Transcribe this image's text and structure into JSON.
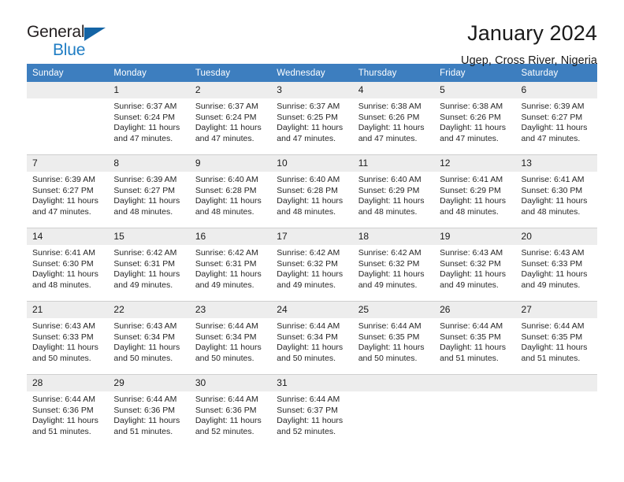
{
  "brand": {
    "line1": "General",
    "line2": "Blue",
    "triangle_icon": "brand-triangle-icon",
    "accent_dark": "#1464a5",
    "accent_light": "#1f7dc4"
  },
  "header": {
    "title": "January 2024",
    "subtitle": "Ugep, Cross River, Nigeria"
  },
  "theme": {
    "header_bg": "#3d7ebf",
    "header_text": "#ffffff",
    "band_bg": "#ededed",
    "row_border": "#cfcfcf",
    "body_text": "#262626"
  },
  "calendar": {
    "columns": [
      "Sunday",
      "Monday",
      "Tuesday",
      "Wednesday",
      "Thursday",
      "Friday",
      "Saturday"
    ],
    "labels": {
      "sunrise": "Sunrise:",
      "sunset": "Sunset:",
      "daylight": "Daylight:"
    },
    "weeks": [
      {
        "banded": true,
        "days": [
          {
            "num": "",
            "sunrise": "",
            "sunset": "",
            "daylight": ""
          },
          {
            "num": "1",
            "sunrise": "Sunrise: 6:37 AM",
            "sunset": "Sunset: 6:24 PM",
            "daylight": "Daylight: 11 hours and 47 minutes."
          },
          {
            "num": "2",
            "sunrise": "Sunrise: 6:37 AM",
            "sunset": "Sunset: 6:24 PM",
            "daylight": "Daylight: 11 hours and 47 minutes."
          },
          {
            "num": "3",
            "sunrise": "Sunrise: 6:37 AM",
            "sunset": "Sunset: 6:25 PM",
            "daylight": "Daylight: 11 hours and 47 minutes."
          },
          {
            "num": "4",
            "sunrise": "Sunrise: 6:38 AM",
            "sunset": "Sunset: 6:26 PM",
            "daylight": "Daylight: 11 hours and 47 minutes."
          },
          {
            "num": "5",
            "sunrise": "Sunrise: 6:38 AM",
            "sunset": "Sunset: 6:26 PM",
            "daylight": "Daylight: 11 hours and 47 minutes."
          },
          {
            "num": "6",
            "sunrise": "Sunrise: 6:39 AM",
            "sunset": "Sunset: 6:27 PM",
            "daylight": "Daylight: 11 hours and 47 minutes."
          }
        ]
      },
      {
        "banded": true,
        "days": [
          {
            "num": "7",
            "sunrise": "Sunrise: 6:39 AM",
            "sunset": "Sunset: 6:27 PM",
            "daylight": "Daylight: 11 hours and 47 minutes."
          },
          {
            "num": "8",
            "sunrise": "Sunrise: 6:39 AM",
            "sunset": "Sunset: 6:27 PM",
            "daylight": "Daylight: 11 hours and 48 minutes."
          },
          {
            "num": "9",
            "sunrise": "Sunrise: 6:40 AM",
            "sunset": "Sunset: 6:28 PM",
            "daylight": "Daylight: 11 hours and 48 minutes."
          },
          {
            "num": "10",
            "sunrise": "Sunrise: 6:40 AM",
            "sunset": "Sunset: 6:28 PM",
            "daylight": "Daylight: 11 hours and 48 minutes."
          },
          {
            "num": "11",
            "sunrise": "Sunrise: 6:40 AM",
            "sunset": "Sunset: 6:29 PM",
            "daylight": "Daylight: 11 hours and 48 minutes."
          },
          {
            "num": "12",
            "sunrise": "Sunrise: 6:41 AM",
            "sunset": "Sunset: 6:29 PM",
            "daylight": "Daylight: 11 hours and 48 minutes."
          },
          {
            "num": "13",
            "sunrise": "Sunrise: 6:41 AM",
            "sunset": "Sunset: 6:30 PM",
            "daylight": "Daylight: 11 hours and 48 minutes."
          }
        ]
      },
      {
        "banded": true,
        "days": [
          {
            "num": "14",
            "sunrise": "Sunrise: 6:41 AM",
            "sunset": "Sunset: 6:30 PM",
            "daylight": "Daylight: 11 hours and 48 minutes."
          },
          {
            "num": "15",
            "sunrise": "Sunrise: 6:42 AM",
            "sunset": "Sunset: 6:31 PM",
            "daylight": "Daylight: 11 hours and 49 minutes."
          },
          {
            "num": "16",
            "sunrise": "Sunrise: 6:42 AM",
            "sunset": "Sunset: 6:31 PM",
            "daylight": "Daylight: 11 hours and 49 minutes."
          },
          {
            "num": "17",
            "sunrise": "Sunrise: 6:42 AM",
            "sunset": "Sunset: 6:32 PM",
            "daylight": "Daylight: 11 hours and 49 minutes."
          },
          {
            "num": "18",
            "sunrise": "Sunrise: 6:42 AM",
            "sunset": "Sunset: 6:32 PM",
            "daylight": "Daylight: 11 hours and 49 minutes."
          },
          {
            "num": "19",
            "sunrise": "Sunrise: 6:43 AM",
            "sunset": "Sunset: 6:32 PM",
            "daylight": "Daylight: 11 hours and 49 minutes."
          },
          {
            "num": "20",
            "sunrise": "Sunrise: 6:43 AM",
            "sunset": "Sunset: 6:33 PM",
            "daylight": "Daylight: 11 hours and 49 minutes."
          }
        ]
      },
      {
        "banded": true,
        "days": [
          {
            "num": "21",
            "sunrise": "Sunrise: 6:43 AM",
            "sunset": "Sunset: 6:33 PM",
            "daylight": "Daylight: 11 hours and 50 minutes."
          },
          {
            "num": "22",
            "sunrise": "Sunrise: 6:43 AM",
            "sunset": "Sunset: 6:34 PM",
            "daylight": "Daylight: 11 hours and 50 minutes."
          },
          {
            "num": "23",
            "sunrise": "Sunrise: 6:44 AM",
            "sunset": "Sunset: 6:34 PM",
            "daylight": "Daylight: 11 hours and 50 minutes."
          },
          {
            "num": "24",
            "sunrise": "Sunrise: 6:44 AM",
            "sunset": "Sunset: 6:34 PM",
            "daylight": "Daylight: 11 hours and 50 minutes."
          },
          {
            "num": "25",
            "sunrise": "Sunrise: 6:44 AM",
            "sunset": "Sunset: 6:35 PM",
            "daylight": "Daylight: 11 hours and 50 minutes."
          },
          {
            "num": "26",
            "sunrise": "Sunrise: 6:44 AM",
            "sunset": "Sunset: 6:35 PM",
            "daylight": "Daylight: 11 hours and 51 minutes."
          },
          {
            "num": "27",
            "sunrise": "Sunrise: 6:44 AM",
            "sunset": "Sunset: 6:35 PM",
            "daylight": "Daylight: 11 hours and 51 minutes."
          }
        ]
      },
      {
        "banded": true,
        "days": [
          {
            "num": "28",
            "sunrise": "Sunrise: 6:44 AM",
            "sunset": "Sunset: 6:36 PM",
            "daylight": "Daylight: 11 hours and 51 minutes."
          },
          {
            "num": "29",
            "sunrise": "Sunrise: 6:44 AM",
            "sunset": "Sunset: 6:36 PM",
            "daylight": "Daylight: 11 hours and 51 minutes."
          },
          {
            "num": "30",
            "sunrise": "Sunrise: 6:44 AM",
            "sunset": "Sunset: 6:36 PM",
            "daylight": "Daylight: 11 hours and 52 minutes."
          },
          {
            "num": "31",
            "sunrise": "Sunrise: 6:44 AM",
            "sunset": "Sunset: 6:37 PM",
            "daylight": "Daylight: 11 hours and 52 minutes."
          },
          {
            "num": "",
            "sunrise": "",
            "sunset": "",
            "daylight": ""
          },
          {
            "num": "",
            "sunrise": "",
            "sunset": "",
            "daylight": ""
          },
          {
            "num": "",
            "sunrise": "",
            "sunset": "",
            "daylight": ""
          }
        ]
      }
    ]
  }
}
